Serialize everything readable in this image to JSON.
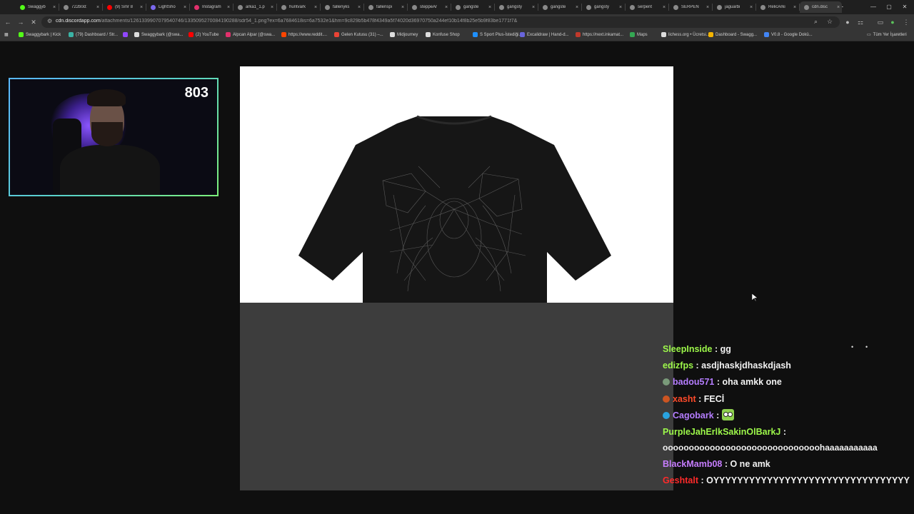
{
  "tabs": [
    {
      "title": "Swaggyb",
      "color": "#53fc18"
    },
    {
      "title": "722b0d:",
      "color": "#8a8a8a"
    },
    {
      "title": "(9) Sıfır 8",
      "color": "#ff0000"
    },
    {
      "title": "LightSho",
      "color": "#7b68ee"
    },
    {
      "title": "Instagram",
      "color": "#e1306c"
    },
    {
      "title": "arka1_1.p",
      "color": "#8a8a8a"
    },
    {
      "title": "huntvark",
      "color": "#8a8a8a"
    },
    {
      "title": "fallenyks",
      "color": "#8a8a8a"
    },
    {
      "title": "fallenspi",
      "color": "#8a8a8a"
    },
    {
      "title": "steppeAr",
      "color": "#8a8a8a"
    },
    {
      "title": "gangste",
      "color": "#8a8a8a"
    },
    {
      "title": "gangsty",
      "color": "#8a8a8a"
    },
    {
      "title": "gangste",
      "color": "#8a8a8a"
    },
    {
      "title": "gangsty",
      "color": "#8a8a8a"
    },
    {
      "title": "serpent",
      "color": "#8a8a8a"
    },
    {
      "title": "SERPEN",
      "color": "#8a8a8a"
    },
    {
      "title": "jaguarbi",
      "color": "#8a8a8a"
    },
    {
      "title": "RelicArki",
      "color": "#8a8a8a"
    },
    {
      "title": "cdn.disc",
      "color": "#8a8a8a",
      "active": true
    }
  ],
  "tab_close_glyph": "×",
  "new_tab_glyph": "+",
  "window_controls": {
    "minimize": "—",
    "maximize": "▢",
    "close": "✕"
  },
  "address": {
    "host": "cdn.discordapp.com",
    "path": "/attachments/1261339907079540746/1335095270084190288/sdr54_1.png?ex=6a7684618is=6a7532e1&hm=9c829b5b478f4349a5f74020d36970750a244ef10b14f8b25e5b9f83be1771f7&"
  },
  "bookmarks": [
    {
      "label": "Swaggybark | Kick",
      "color": "#53fc18"
    },
    {
      "label": "(79) Dashboard / Str...",
      "color": "#3bb3a5"
    },
    {
      "label": "",
      "color": "#9147ff"
    },
    {
      "label": "Swaggybark (@swa...",
      "color": "#dddddd"
    },
    {
      "label": "(2) YouTube",
      "color": "#ff0000"
    },
    {
      "label": "Alpcan Alpar (@swa...",
      "color": "#e1306c"
    },
    {
      "label": "https://www.reddit....",
      "color": "#ff4500"
    },
    {
      "label": "Gelen Kutusu (31) –...",
      "color": "#ea4335"
    },
    {
      "label": "Midjourney",
      "color": "#dddddd"
    },
    {
      "label": "Konfuse Shop",
      "color": "#dddddd"
    },
    {
      "label": "S Sport Plus-İstediği...",
      "color": "#1e90ff"
    },
    {
      "label": "Excalidraw | Hand-d...",
      "color": "#6965db"
    },
    {
      "label": "https://next.inkamat...",
      "color": "#c0392b"
    },
    {
      "label": "Maps",
      "color": "#34a853"
    },
    {
      "label": "lichess.org • Ücretsi...",
      "color": "#dddddd"
    },
    {
      "label": "Dashboard - Swagg...",
      "color": "#f4b400"
    },
    {
      "label": "V0.8 - Google Dokü...",
      "color": "#4285f4"
    }
  ],
  "all_bookmarks": "Tüm Yer İşaretleri",
  "viewer_count": "803",
  "chat": [
    {
      "user": "SleepInside",
      "color": "#9df84a",
      "badge": null,
      "msg": "gg"
    },
    {
      "user": "edizfps",
      "color": "#9df84a",
      "badge": null,
      "msg": "asdjhaskjdhaskdjash"
    },
    {
      "user": "badou571",
      "color": "#b57dff",
      "badge": "#7a9a7a",
      "msg": "oha amkk one"
    },
    {
      "user": "xasht",
      "color": "#ff4a2a",
      "badge": "#cc5522",
      "msg": "FECİ"
    },
    {
      "user": "Cagobark",
      "color": "#b57dff",
      "badge": "#29a3e0",
      "msg": "",
      "emote": true
    },
    {
      "user": "PurpleJahErlkSakinOlBarkJ",
      "color": "#9df84a",
      "badge": null,
      "msg": ""
    },
    {
      "continuation": "oooooooooooooooooooooooooooooohaaaaaaaaaaa"
    },
    {
      "user": "BlackMamb08",
      "color": "#c77dff",
      "badge": null,
      "msg": "O ne amk"
    },
    {
      "user": "Geshtalt",
      "color": "#ff2a2a",
      "badge": null,
      "msg": "OYYYYYYYYYYYYYYYYYYYYYYYYYYYYYYYYY"
    }
  ],
  "chat_separator": " : "
}
